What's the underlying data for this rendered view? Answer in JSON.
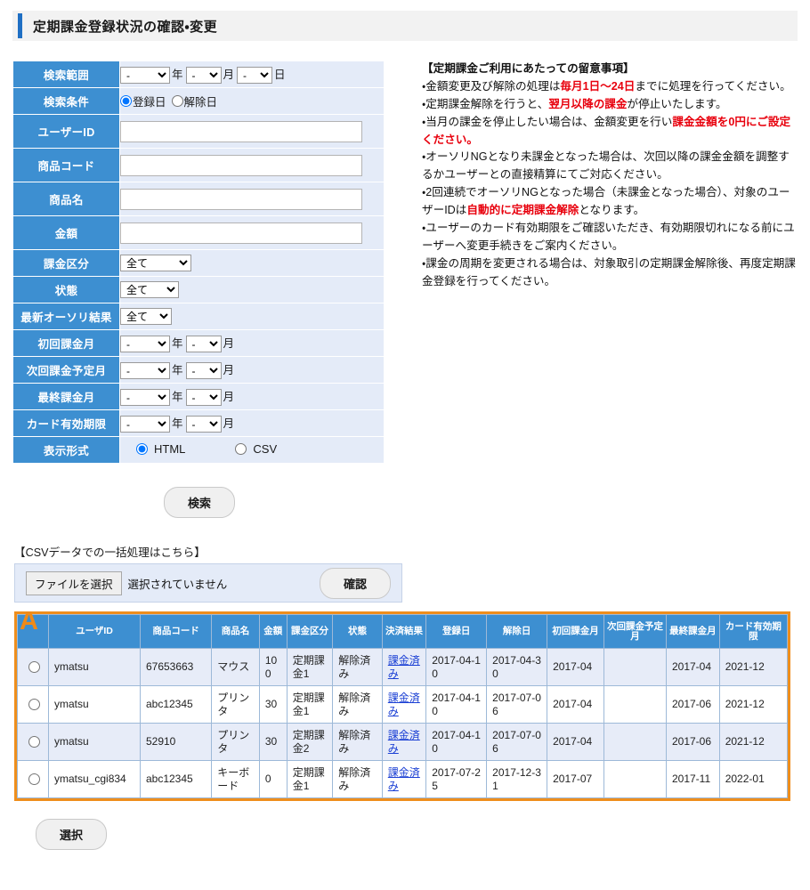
{
  "page": {
    "title": "定期課金登録状況の確認・変更",
    "annotation_marker": "A"
  },
  "search_form": {
    "rows": {
      "range_label": "検索範囲",
      "range_year": "-",
      "range_year_unit": "年",
      "range_month": "-",
      "range_month_unit": "月",
      "range_day": "-",
      "range_day_unit": "日",
      "condition_label": "検索条件",
      "condition_opt1": "登録日",
      "condition_opt2": "解除日",
      "user_id_label": "ユーザーID",
      "user_id_value": "",
      "product_code_label": "商品コード",
      "product_code_value": "",
      "product_name_label": "商品名",
      "product_name_value": "",
      "amount_label": "金額",
      "amount_value": "",
      "charge_type_label": "課金区分",
      "charge_type_value": "全て",
      "status_label": "状態",
      "status_value": "全て",
      "auth_result_label": "最新オーソリ結果",
      "auth_result_value": "全て",
      "first_charge_label": "初回課金月",
      "first_charge_year": "-",
      "first_charge_month": "-",
      "next_charge_label": "次回課金予定月",
      "next_charge_year": "-",
      "next_charge_month": "-",
      "last_charge_label": "最終課金月",
      "last_charge_year": "-",
      "last_charge_month": "-",
      "card_expiry_label": "カード有効期限",
      "card_expiry_year": "-",
      "card_expiry_month": "-",
      "display_format_label": "表示形式",
      "display_html": "HTML",
      "display_csv": "CSV",
      "year_unit": "年",
      "month_unit": "月"
    },
    "search_button": "検索"
  },
  "notice": {
    "heading": "【定期課金ご利用にあたっての留意事項】",
    "lines": [
      {
        "pre": "・金額変更及び解除の処理は",
        "red": "毎月1日～24日",
        "post": "までに処理を行ってください。"
      },
      {
        "pre": "・定期課金解除を行うと、",
        "red": "翌月以降の課金",
        "post": "が停止いたします。"
      },
      {
        "pre": "・当月の課金を停止したい場合は、金額変更を行い",
        "red": "課金金額を0円にご設定ください。",
        "post": ""
      },
      {
        "pre": "・オーソリNGとなり未課金となった場合は、次回以降の課金金額を調整するかユーザーとの直接精算にてご対応ください。",
        "red": "",
        "post": ""
      },
      {
        "pre": "・2回連続でオーソリNGとなった場合（未課金となった場合）、対象のユーザーIDは",
        "red": "自動的に定期課金解除",
        "post": "となります。"
      },
      {
        "pre": "・ユーザーのカード有効期限をご確認いただき、有効期限切れになる前にユーザーへ変更手続きをご案内ください。",
        "red": "",
        "post": ""
      },
      {
        "pre": "・課金の周期を変更される場合は、対象取引の定期課金解除後、再度定期課金登録を行ってください。",
        "red": "",
        "post": ""
      }
    ]
  },
  "csv_section": {
    "label": "【CSVデータでの一括処理はこちら】",
    "file_button": "ファイルを選択",
    "file_status": "選択されていません",
    "confirm_button": "確認"
  },
  "results_table": {
    "headers": [
      "",
      "ユーザID",
      "商品コード",
      "商品名",
      "金額",
      "課金区分",
      "状態",
      "決済結果",
      "登録日",
      "解除日",
      "初回課金月",
      "次回課金予定月",
      "最終課金月",
      "カード有効期限"
    ],
    "rows": [
      {
        "user_id": "ymatsu",
        "product_code": "67653663",
        "product_name": "マウス",
        "amount": "100",
        "charge_type": "定期課金1",
        "status": "解除済み",
        "pay_result": "課金済み",
        "registered": "2017-04-10",
        "cancelled": "2017-04-30",
        "first_month": "2017-04",
        "next_month": "",
        "last_month": "2017-04",
        "card_expiry": "2021-12"
      },
      {
        "user_id": "ymatsu",
        "product_code": "abc12345",
        "product_name": "プリンタ",
        "amount": "30",
        "charge_type": "定期課金1",
        "status": "解除済み",
        "pay_result": "課金済み",
        "registered": "2017-04-10",
        "cancelled": "2017-07-06",
        "first_month": "2017-04",
        "next_month": "",
        "last_month": "2017-06",
        "card_expiry": "2021-12"
      },
      {
        "user_id": "ymatsu",
        "product_code": "52910",
        "product_name": "プリンタ",
        "amount": "30",
        "charge_type": "定期課金2",
        "status": "解除済み",
        "pay_result": "課金済み",
        "registered": "2017-04-10",
        "cancelled": "2017-07-06",
        "first_month": "2017-04",
        "next_month": "",
        "last_month": "2017-06",
        "card_expiry": "2021-12"
      },
      {
        "user_id": "ymatsu_cgi834",
        "product_code": "abc12345",
        "product_name": "キーボード",
        "amount": "0",
        "charge_type": "定期課金1",
        "status": "解除済み",
        "pay_result": "課金済み",
        "registered": "2017-07-25",
        "cancelled": "2017-12-31",
        "first_month": "2017-07",
        "next_month": "",
        "last_month": "2017-11",
        "card_expiry": "2022-01"
      }
    ]
  },
  "footer": {
    "select_button": "選択"
  },
  "colors": {
    "header_blue": "#3d8fd1",
    "panel_blue": "#e4ebf8",
    "accent_orange": "#ef8e1c",
    "red_text": "#e8000d",
    "link_blue": "#1a3fd4"
  }
}
